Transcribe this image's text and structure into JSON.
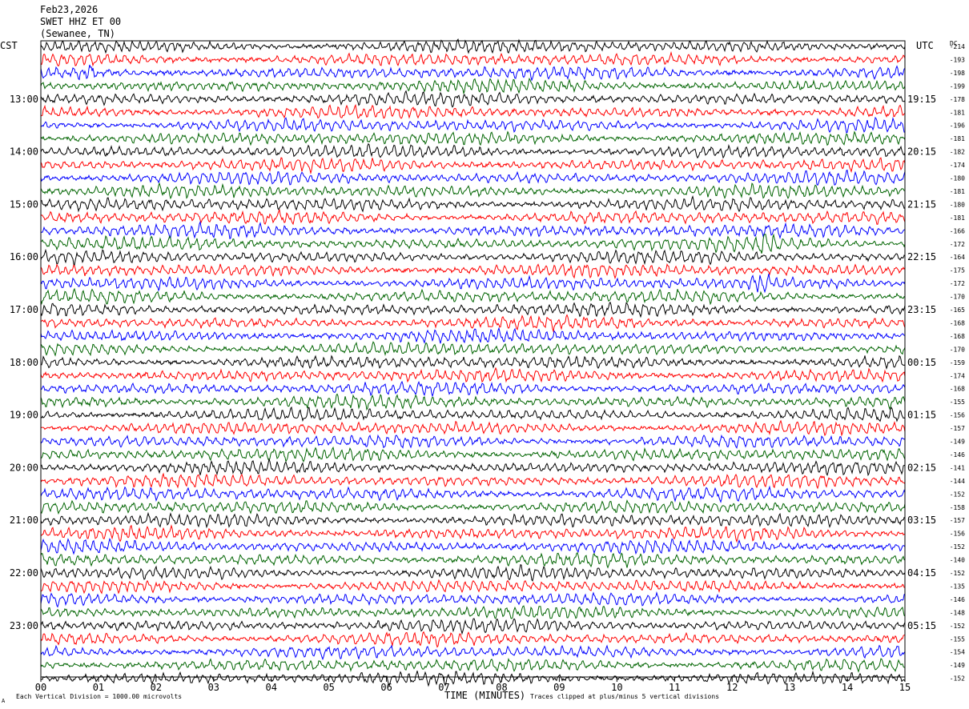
{
  "header": {
    "date": "Feb23,2026",
    "station": "SWET HHZ ET 00",
    "location": "(Sewanee, TN)"
  },
  "timezones": {
    "left": "CST",
    "right": "UTC"
  },
  "dc_label": "DC",
  "footer": {
    "left": "Each Vertical Division = 1000.00 microvolts",
    "right": "Traces clipped at plus/minus 5 vertical divisions",
    "corner": "A"
  },
  "colors": {
    "trace_cycle": [
      "#000000",
      "#ff0000",
      "#0000ff",
      "#006400"
    ]
  },
  "chart_data": {
    "type": "line",
    "xlabel": "TIME (MINUTES)",
    "x_ticks": [
      "00",
      "01",
      "02",
      "03",
      "04",
      "05",
      "06",
      "07",
      "08",
      "09",
      "10",
      "11",
      "12",
      "13",
      "14",
      "15"
    ],
    "xlim": [
      0,
      15
    ],
    "rows_per_hour": 4,
    "left_hour_labels": [
      "13:00",
      "14:00",
      "15:00",
      "16:00",
      "17:00",
      "18:00",
      "19:00",
      "20:00",
      "21:00",
      "22:00",
      "23:00"
    ],
    "right_hour_labels": [
      "19:15",
      "20:15",
      "21:15",
      "22:15",
      "23:15",
      "00:15",
      "01:15",
      "02:15",
      "03:15",
      "04:15",
      "05:15"
    ],
    "hour_label_first_row": 4,
    "dc_offsets": [
      "-214",
      "-193",
      "-198",
      "-199",
      "-178",
      "-181",
      "-196",
      "-181",
      "-182",
      "-174",
      "-180",
      "-181",
      "-180",
      "-181",
      "-166",
      "-172",
      "-164",
      "-175",
      "-172",
      "-170",
      "-165",
      "-168",
      "-168",
      "-170",
      "-159",
      "-174",
      "-168",
      "-155",
      "-156",
      "-157",
      "-149",
      "-146",
      "-141",
      "-144",
      "-152",
      "-158",
      "-157",
      "-156",
      "-152",
      "-140",
      "-152",
      "-135",
      "-146",
      "-148",
      "-152",
      "-155",
      "-154",
      "-149",
      "-152"
    ],
    "events": [
      {
        "row": 15,
        "minute": 12.6,
        "note": "burst"
      },
      {
        "row": 18,
        "minute": 12.5,
        "note": "burst"
      },
      {
        "row": 2,
        "minute": 0.8,
        "note": "burst"
      }
    ]
  }
}
